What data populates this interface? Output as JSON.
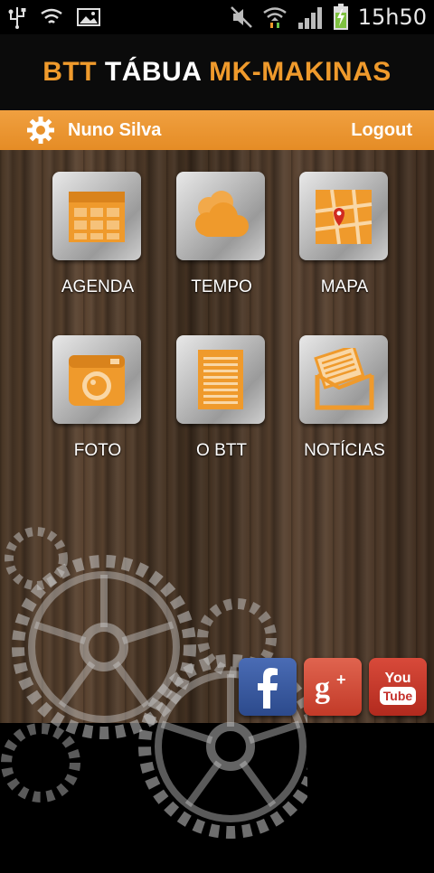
{
  "status_bar": {
    "time": "15h50",
    "icons": [
      "usb-icon",
      "wifi-shield-icon",
      "image-icon",
      "mute-icon",
      "wifi-icon",
      "signal-icon",
      "battery-charging-icon"
    ]
  },
  "header": {
    "title_part1": "BTT",
    "title_part2": "TÁBUA",
    "title_part3": "MK-MAKINAS"
  },
  "userbar": {
    "icon": "gear-icon",
    "user_name": "Nuno Silva",
    "logout_label": "Logout"
  },
  "tiles": [
    {
      "label": "AGENDA",
      "icon": "calendar-icon"
    },
    {
      "label": "TEMPO",
      "icon": "cloud-icon"
    },
    {
      "label": "MAPA",
      "icon": "map-icon"
    },
    {
      "label": "FOTO",
      "icon": "camera-icon"
    },
    {
      "label": "O BTT",
      "icon": "document-icon"
    },
    {
      "label": "NOTÍCIAS",
      "icon": "news-icon"
    }
  ],
  "social": [
    {
      "name": "facebook",
      "icon": "facebook-icon",
      "color": "#3b5998",
      "text": "f"
    },
    {
      "name": "google-plus",
      "icon": "google-plus-icon",
      "color": "#d34836",
      "text": "g+"
    },
    {
      "name": "youtube",
      "icon": "youtube-icon",
      "color": "#c4302b",
      "text_top": "You",
      "text_bottom": "Tube"
    }
  ],
  "colors": {
    "accent": "#ef9a2c",
    "header_bg": "#0b0b0b"
  }
}
